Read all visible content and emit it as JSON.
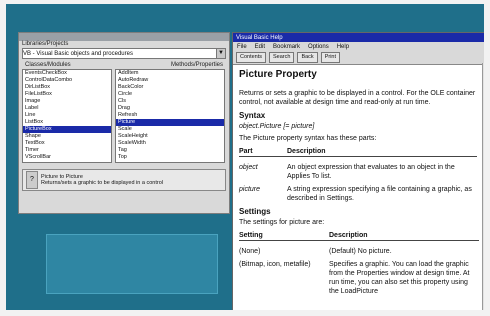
{
  "desktop": {},
  "browser": {
    "libs_label": "Libraries/Projects",
    "libs_value": "VB - Visual Basic objects and procedures",
    "modules_header": "Classes/Modules",
    "methods_header": "Methods/Properties",
    "left_list": [
      "EventsCheckBox",
      "ControlDataCombo",
      "DirListBox",
      "FileListBox",
      "Image",
      "Label",
      "Line",
      "ListBox",
      "PictureBox",
      "Shape",
      "TextBox",
      "Timer",
      "VScrollBar"
    ],
    "left_selected_index": 8,
    "right_list": [
      "AddItem",
      "AutoRedraw",
      "BackColor",
      "Circle",
      "Cls",
      "Drag",
      "Refresh",
      "Picture",
      "Scale",
      "ScaleHeight",
      "ScaleWidth",
      "Tag",
      "Top"
    ],
    "right_selected_index": 7,
    "info_button": "?",
    "info_line1": "Picture to Picture",
    "info_line2": "Returns/sets a graphic to be displayed in a control"
  },
  "help": {
    "title": "Visual Basic Help",
    "menu": [
      "File",
      "Edit",
      "Bookmark",
      "Options",
      "Help"
    ],
    "buttons": [
      "Contents",
      "Search",
      "Back",
      "Print"
    ],
    "heading": "Picture Property",
    "intro": "Returns or sets a graphic to be displayed in a control. For the OLE container control, not available at design time and read-only at run time.",
    "syntax_heading": "Syntax",
    "syntax": "object.Picture [= picture]",
    "syntax_desc": "The Picture property syntax has these parts:",
    "parts_header_part": "Part",
    "parts_header_desc": "Description",
    "parts": [
      {
        "part": "object",
        "desc": "An object expression that evaluates to an object in the Applies To list."
      },
      {
        "part": "picture",
        "desc": "A string expression specifying a file containing a graphic, as described in Settings."
      }
    ],
    "settings_heading": "Settings",
    "settings_desc": "The settings for picture are:",
    "settings_header_setting": "Setting",
    "settings_header_desc": "Description",
    "settings": [
      {
        "setting": "(None)",
        "desc": "(Default) No picture."
      },
      {
        "setting": "(Bitmap, icon, metafile)",
        "desc": "Specifies a graphic. You can load the graphic from the Properties window at design time. At run time, you can also set this property using the LoadPicture"
      }
    ]
  }
}
